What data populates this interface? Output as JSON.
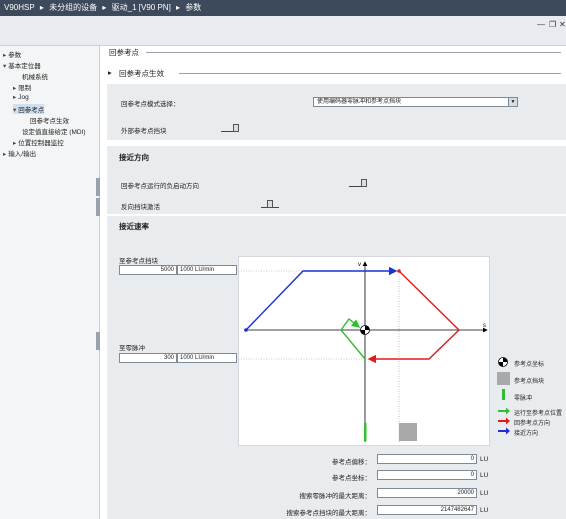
{
  "breadcrumb": [
    "V90HSP",
    "未分组的设备",
    "驱动_1 [V90 PN]",
    "参数"
  ],
  "sidebar": {
    "items": [
      {
        "label": "参数",
        "arrow": "▸"
      },
      {
        "label": "基本定位器",
        "arrow": "▾"
      },
      {
        "label": "机械系统",
        "arrow": ""
      },
      {
        "label": "限制",
        "arrow": "▸"
      },
      {
        "label": "Jog",
        "arrow": "▸"
      },
      {
        "label": "回参考点",
        "arrow": "▾"
      },
      {
        "label": "回参考点生效",
        "arrow": ""
      },
      {
        "label": "设定值直接给定 (MDI)",
        "arrow": ""
      },
      {
        "label": "位置控制器监控",
        "arrow": "▸"
      },
      {
        "label": "输入/输出",
        "arrow": "▸"
      }
    ]
  },
  "main": {
    "section_title": "回参考点",
    "subsection_title": "回参考点生效",
    "mode_label": "回参考点模式选择：",
    "mode_value": "使用编码器零脉冲和参考点挡块",
    "external_cam_label": "外部参考点挡块",
    "approach_dir_title": "接近方向",
    "neg_start_label": "回参考点运行的负启动方向",
    "reverse_cam_label": "反向挡块激活",
    "approach_speed_title": "接近速率",
    "to_cam_label": "至参考点挡块",
    "to_cam_value": "5000",
    "to_cam_unit": "1000 LU/min",
    "to_zero_label": "至零脉冲",
    "to_zero_value": "300",
    "to_zero_unit": "1000 LU/min",
    "axis_v": "v",
    "axis_s": "s",
    "legend": {
      "ref_coord": "参考点坐标",
      "ref_cam": "参考点挡块",
      "zero_pulse": "零脉冲",
      "run_to_ref": "运行至参考点位置",
      "ref_dir": "回参考点方向",
      "approach_dir": "接近方向"
    },
    "fields": [
      {
        "label": "参考点偏移：",
        "value": "0",
        "unit": "LU"
      },
      {
        "label": "参考点坐标：",
        "value": "0",
        "unit": "LU"
      },
      {
        "label": "搜索零脉冲的最大距离：",
        "value": "20000",
        "unit": "LU"
      },
      {
        "label": "搜索参考点挡块的最大距离：",
        "value": "2147482647",
        "unit": "LU"
      }
    ],
    "colors": {
      "blue": "#1f2fd6",
      "red": "#e21a1a",
      "green": "#2fbf2f",
      "gray": "#a9a9a9"
    }
  }
}
